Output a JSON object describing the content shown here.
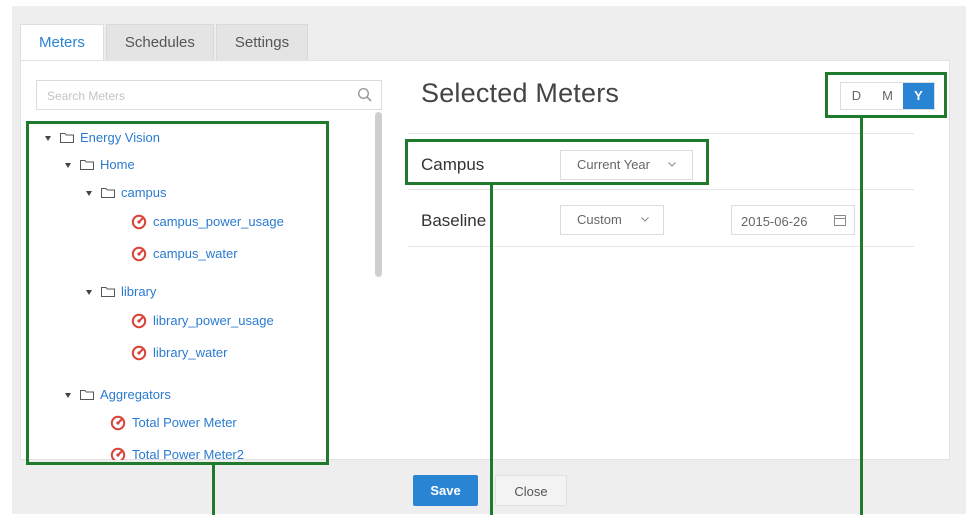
{
  "tabs": [
    {
      "label": "Meters",
      "active": true
    },
    {
      "label": "Schedules",
      "active": false
    },
    {
      "label": "Settings",
      "active": false
    }
  ],
  "search": {
    "placeholder": "Search Meters",
    "icon": "search-icon"
  },
  "tree": {
    "root": {
      "label": "Energy Vision"
    },
    "home": {
      "label": "Home"
    },
    "campus": {
      "label": "campus"
    },
    "campus_power_usage": {
      "label": "campus_power_usage"
    },
    "campus_water": {
      "label": "campus_water"
    },
    "library": {
      "label": "library"
    },
    "library_power_usage": {
      "label": "library_power_usage"
    },
    "library_water": {
      "label": "library_water"
    },
    "aggregators": {
      "label": "Aggregators"
    },
    "total_power_meter": {
      "label": "Total Power Meter"
    },
    "total_power_meter2": {
      "label": "Total Power Meter2"
    }
  },
  "selected": {
    "title": "Selected Meters",
    "period_buttons": [
      {
        "label": "D",
        "active": false
      },
      {
        "label": "M",
        "active": false
      },
      {
        "label": "Y",
        "active": true
      }
    ],
    "rows": [
      {
        "label": "Campus",
        "range": "Current Year"
      },
      {
        "label": "Baseline",
        "range": "Custom",
        "date": "2015-06-26"
      }
    ]
  },
  "footer": {
    "save": "Save",
    "close": "Close"
  },
  "colors": {
    "accent": "#2a84d4",
    "callout": "#1f7a2e",
    "meter_icon": "#d9443a"
  }
}
